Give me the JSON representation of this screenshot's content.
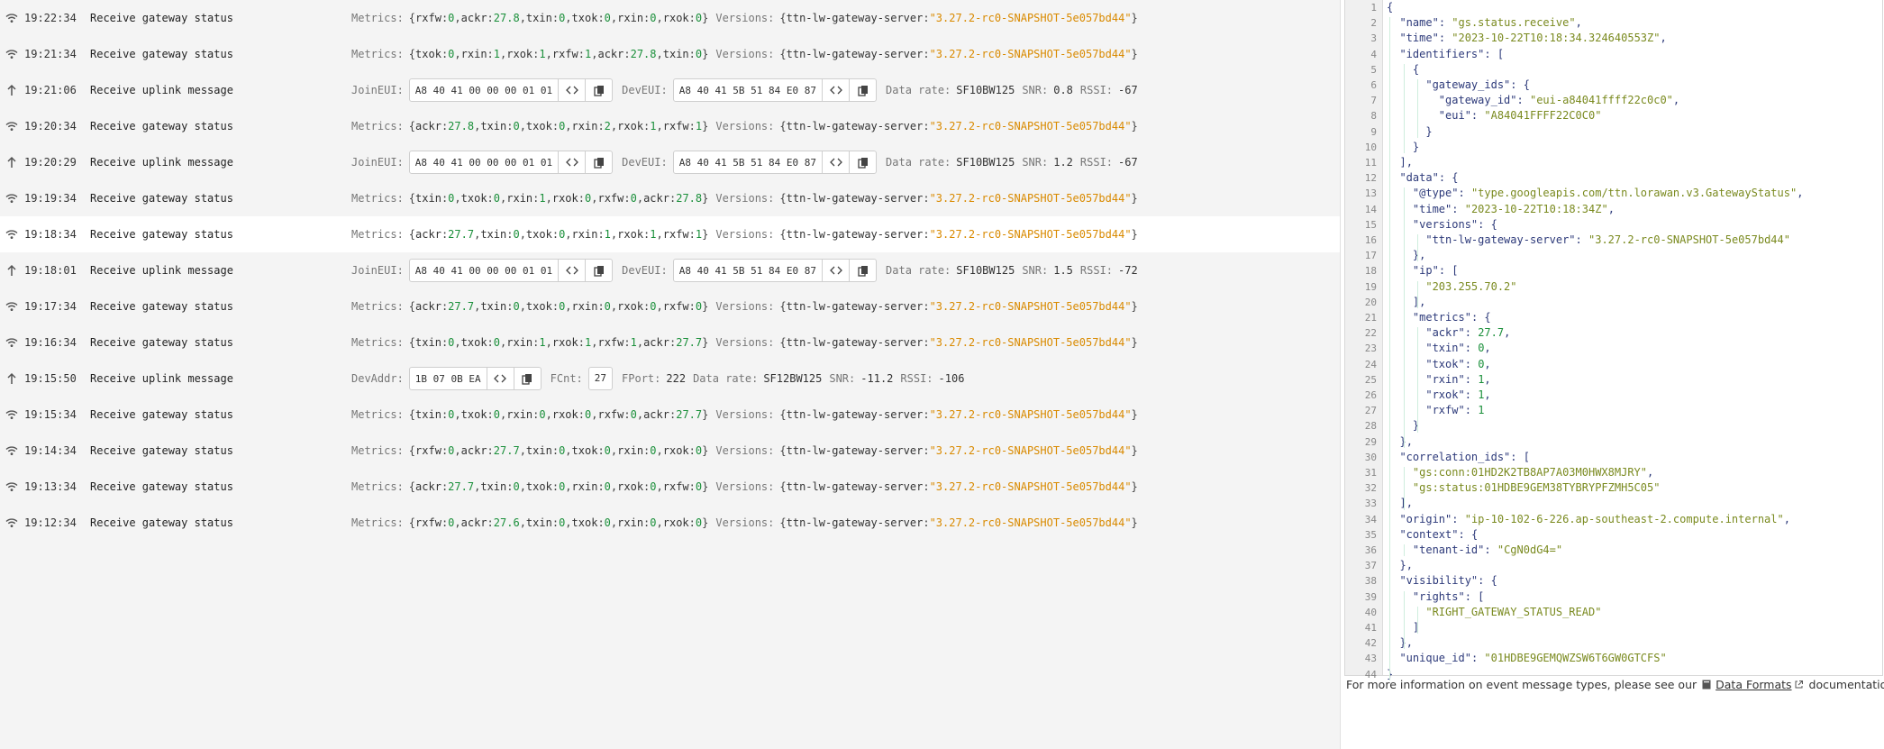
{
  "events": [
    {
      "time": "19:22:34",
      "type": "gateway",
      "name": "Receive gateway status",
      "metrics": [
        [
          "rxfw",
          "0"
        ],
        [
          "ackr",
          "27.8"
        ],
        [
          "txin",
          "0"
        ],
        [
          "txok",
          "0"
        ],
        [
          "rxin",
          "0"
        ],
        [
          "rxok",
          "0"
        ]
      ],
      "version_key": "ttn-lw-gateway-server",
      "version_val": "\"3.27.2-rc0-SNAPSHOT-5e057bd44\""
    },
    {
      "time": "19:21:34",
      "type": "gateway",
      "name": "Receive gateway status",
      "metrics": [
        [
          "txok",
          "0"
        ],
        [
          "rxin",
          "1"
        ],
        [
          "rxok",
          "1"
        ],
        [
          "rxfw",
          "1"
        ],
        [
          "ackr",
          "27.8"
        ],
        [
          "txin",
          "0"
        ]
      ],
      "version_key": "ttn-lw-gateway-server",
      "version_val": "\"3.27.2-rc0-SNAPSHOT-5e057bd44\""
    },
    {
      "time": "19:21:06",
      "type": "uplink",
      "name": "Receive uplink message",
      "join_eui": "A8 40 41 00 00 00 01 01",
      "dev_eui": "A8 40 41 5B 51 84 E0 87",
      "data_rate": "SF10BW125",
      "snr": "0.8",
      "rssi": "-67"
    },
    {
      "time": "19:20:34",
      "type": "gateway",
      "name": "Receive gateway status",
      "metrics": [
        [
          "ackr",
          "27.8"
        ],
        [
          "txin",
          "0"
        ],
        [
          "txok",
          "0"
        ],
        [
          "rxin",
          "2"
        ],
        [
          "rxok",
          "1"
        ],
        [
          "rxfw",
          "1"
        ]
      ],
      "version_key": "ttn-lw-gateway-server",
      "version_val": "\"3.27.2-rc0-SNAPSHOT-5e057bd44\""
    },
    {
      "time": "19:20:29",
      "type": "uplink",
      "name": "Receive uplink message",
      "join_eui": "A8 40 41 00 00 00 01 01",
      "dev_eui": "A8 40 41 5B 51 84 E0 87",
      "data_rate": "SF10BW125",
      "snr": "1.2",
      "rssi": "-67"
    },
    {
      "time": "19:19:34",
      "type": "gateway",
      "name": "Receive gateway status",
      "metrics": [
        [
          "txin",
          "0"
        ],
        [
          "txok",
          "0"
        ],
        [
          "rxin",
          "1"
        ],
        [
          "rxok",
          "0"
        ],
        [
          "rxfw",
          "0"
        ],
        [
          "ackr",
          "27.8"
        ]
      ],
      "version_key": "ttn-lw-gateway-server",
      "version_val": "\"3.27.2-rc0-SNAPSHOT-5e057bd44\""
    },
    {
      "time": "19:18:34",
      "type": "gateway",
      "selected": true,
      "name": "Receive gateway status",
      "metrics": [
        [
          "ackr",
          "27.7"
        ],
        [
          "txin",
          "0"
        ],
        [
          "txok",
          "0"
        ],
        [
          "rxin",
          "1"
        ],
        [
          "rxok",
          "1"
        ],
        [
          "rxfw",
          "1"
        ]
      ],
      "version_key": "ttn-lw-gateway-server",
      "version_val": "\"3.27.2-rc0-SNAPSHOT-5e057bd44\""
    },
    {
      "time": "19:18:01",
      "type": "uplink",
      "name": "Receive uplink message",
      "join_eui": "A8 40 41 00 00 00 01 01",
      "dev_eui": "A8 40 41 5B 51 84 E0 87",
      "data_rate": "SF10BW125",
      "snr": "1.5",
      "rssi": "-72"
    },
    {
      "time": "19:17:34",
      "type": "gateway",
      "name": "Receive gateway status",
      "metrics": [
        [
          "ackr",
          "27.7"
        ],
        [
          "txin",
          "0"
        ],
        [
          "txok",
          "0"
        ],
        [
          "rxin",
          "0"
        ],
        [
          "rxok",
          "0"
        ],
        [
          "rxfw",
          "0"
        ]
      ],
      "version_key": "ttn-lw-gateway-server",
      "version_val": "\"3.27.2-rc0-SNAPSHOT-5e057bd44\""
    },
    {
      "time": "19:16:34",
      "type": "gateway",
      "name": "Receive gateway status",
      "metrics": [
        [
          "txin",
          "0"
        ],
        [
          "txok",
          "0"
        ],
        [
          "rxin",
          "1"
        ],
        [
          "rxok",
          "1"
        ],
        [
          "rxfw",
          "1"
        ],
        [
          "ackr",
          "27.7"
        ]
      ],
      "version_key": "ttn-lw-gateway-server",
      "version_val": "\"3.27.2-rc0-SNAPSHOT-5e057bd44\""
    },
    {
      "time": "19:15:50",
      "type": "uplink_abp",
      "name": "Receive uplink message",
      "dev_addr": "1B 07 0B EA",
      "fcnt": "27",
      "fport": "222",
      "data_rate": "SF12BW125",
      "snr": "-11.2",
      "rssi": "-106"
    },
    {
      "time": "19:15:34",
      "type": "gateway",
      "name": "Receive gateway status",
      "metrics": [
        [
          "txin",
          "0"
        ],
        [
          "txok",
          "0"
        ],
        [
          "rxin",
          "0"
        ],
        [
          "rxok",
          "0"
        ],
        [
          "rxfw",
          "0"
        ],
        [
          "ackr",
          "27.7"
        ]
      ],
      "version_key": "ttn-lw-gateway-server",
      "version_val": "\"3.27.2-rc0-SNAPSHOT-5e057bd44\""
    },
    {
      "time": "19:14:34",
      "type": "gateway",
      "name": "Receive gateway status",
      "metrics": [
        [
          "rxfw",
          "0"
        ],
        [
          "ackr",
          "27.7"
        ],
        [
          "txin",
          "0"
        ],
        [
          "txok",
          "0"
        ],
        [
          "rxin",
          "0"
        ],
        [
          "rxok",
          "0"
        ]
      ],
      "version_key": "ttn-lw-gateway-server",
      "version_val": "\"3.27.2-rc0-SNAPSHOT-5e057bd44\""
    },
    {
      "time": "19:13:34",
      "type": "gateway",
      "name": "Receive gateway status",
      "metrics": [
        [
          "ackr",
          "27.7"
        ],
        [
          "txin",
          "0"
        ],
        [
          "txok",
          "0"
        ],
        [
          "rxin",
          "0"
        ],
        [
          "rxok",
          "0"
        ],
        [
          "rxfw",
          "0"
        ]
      ],
      "version_key": "ttn-lw-gateway-server",
      "version_val": "\"3.27.2-rc0-SNAPSHOT-5e057bd44\""
    },
    {
      "time": "19:12:34",
      "type": "gateway",
      "name": "Receive gateway status",
      "metrics": [
        [
          "rxfw",
          "0"
        ],
        [
          "ackr",
          "27.6"
        ],
        [
          "txin",
          "0"
        ],
        [
          "txok",
          "0"
        ],
        [
          "rxin",
          "0"
        ],
        [
          "rxok",
          "0"
        ]
      ],
      "version_key": "ttn-lw-gateway-server",
      "version_val": "\"3.27.2-rc0-SNAPSHOT-5e057bd44\""
    }
  ],
  "labels": {
    "metrics": "Metrics:",
    "versions": "Versions:",
    "join_eui": "JoinEUI:",
    "dev_eui": "DevEUI:",
    "dev_addr": "DevAddr:",
    "fcnt": "FCnt:",
    "fport": "FPort:",
    "data_rate": "Data rate:",
    "snr": "SNR:",
    "rssi": "RSSI:"
  },
  "json_lines": [
    "{",
    "  \"name\": \"gs.status.receive\",",
    "  \"time\": \"2023-10-22T10:18:34.324640553Z\",",
    "  \"identifiers\": [",
    "    {",
    "      \"gateway_ids\": {",
    "        \"gateway_id\": \"eui-a84041ffff22c0c0\",",
    "        \"eui\": \"A84041FFFF22C0C0\"",
    "      }",
    "    }",
    "  ],",
    "  \"data\": {",
    "    \"@type\": \"type.googleapis.com/ttn.lorawan.v3.GatewayStatus\",",
    "    \"time\": \"2023-10-22T10:18:34Z\",",
    "    \"versions\": {",
    "      \"ttn-lw-gateway-server\": \"3.27.2-rc0-SNAPSHOT-5e057bd44\"",
    "    },",
    "    \"ip\": [",
    "      \"203.255.70.2\"",
    "    ],",
    "    \"metrics\": {",
    "      \"ackr\": 27.7,",
    "      \"txin\": 0,",
    "      \"txok\": 0,",
    "      \"rxin\": 1,",
    "      \"rxok\": 1,",
    "      \"rxfw\": 1",
    "    }",
    "  },",
    "  \"correlation_ids\": [",
    "    \"gs:conn:01HD2K2TB8AP7A03M0HWX8MJRY\",",
    "    \"gs:status:01HDBE9GEM38TYBRYPFZMH5C05\"",
    "  ],",
    "  \"origin\": \"ip-10-102-6-226.ap-southeast-2.compute.internal\",",
    "  \"context\": {",
    "    \"tenant-id\": \"CgN0dG4=\"",
    "  },",
    "  \"visibility\": {",
    "    \"rights\": [",
    "      \"RIGHT_GATEWAY_STATUS_READ\"",
    "    ]",
    "  },",
    "  \"unique_id\": \"01HDBE9GEMQWZSW6T6GW0GTCFS\"",
    "}"
  ],
  "footer": {
    "prefix": "For more information on event message types, please see our",
    "link": "Data Formats",
    "suffix": "documentation."
  }
}
